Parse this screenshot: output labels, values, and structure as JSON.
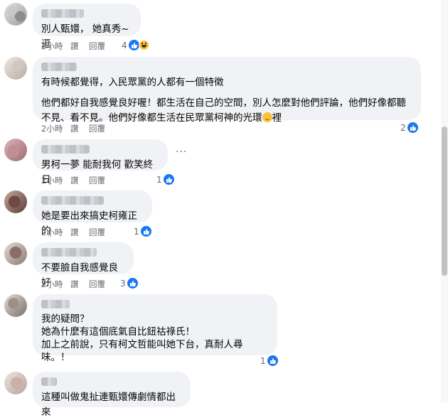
{
  "actions": {
    "like": "讚",
    "reply": "回覆"
  },
  "more_label": "···",
  "comments": [
    {
      "time": "2小時",
      "text": [
        "別人甄嬛， 她真秀~逗"
      ],
      "reactions": "4",
      "reaction_icons": [
        "like-icon",
        "haha-icon"
      ]
    },
    {
      "time": "2小時",
      "text": [
        "有時候都覺得，入民眾黨的人都有一個特徵",
        "他們都好自我感覺良好喔！都生活在自己的空間，別人怎麼對他們評論，他們好像都聽\n不見、看不見。他們好像都生活在民眾黨柯神的光環",
        "裡"
      ],
      "reactions": "2",
      "reaction_icons": [
        "like-icon"
      ],
      "inline_emoji": "smiling-face-with-halo"
    },
    {
      "time": "2小時",
      "text": [
        "男柯一夢 能耐我何 歡笑終日"
      ],
      "reactions": "1",
      "reaction_icons": [
        "like-icon"
      ]
    },
    {
      "time": "2小時",
      "text": [
        "她是要出來搞史柯雍正的"
      ],
      "reactions": "1",
      "reaction_icons": [
        "like-icon"
      ]
    },
    {
      "time": "2小時",
      "text": [
        "不要臉自我感覺良好"
      ],
      "reactions": "3",
      "reaction_icons": [
        "like-icon"
      ]
    },
    {
      "time": "",
      "text": [
        "我的疑問？\n她為什麼有這個底氣自比鈕祜祿氏！\n加上之前說，只有柯文哲能叫她下台，真耐人尋味。！"
      ],
      "reactions": "1",
      "reaction_icons": [
        "like-icon"
      ]
    },
    {
      "time": "",
      "text": [
        "這種叫做鬼扯連甄嬛傳劇情都出來"
      ],
      "reactions": "",
      "reaction_icons": []
    }
  ]
}
